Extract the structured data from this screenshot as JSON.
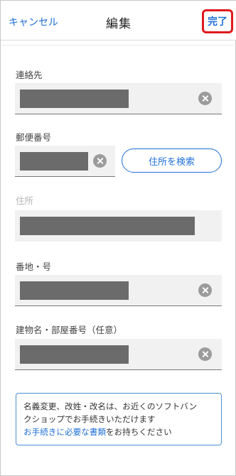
{
  "header": {
    "cancel_label": "キャンセル",
    "title": "編集",
    "done_label": "完了"
  },
  "form": {
    "contact": {
      "label": "連絡先"
    },
    "postal_code": {
      "label": "郵便番号",
      "search_button": "住所を検索"
    },
    "address": {
      "label": "住所"
    },
    "street_number": {
      "label": "番地・号"
    },
    "building": {
      "label": "建物名・部屋番号（任意）"
    }
  },
  "notice": {
    "line1": "名義変更、改姓・改名は、お近くのソフトバン",
    "line2": "クショップでお手続きいただけます",
    "link_text": "お手続きに必要な書類",
    "line3_rest": "をお持ちください"
  },
  "colors": {
    "accent": "#1f6fd6",
    "highlight": "#e0191f",
    "masked": "#6b6b6b"
  }
}
